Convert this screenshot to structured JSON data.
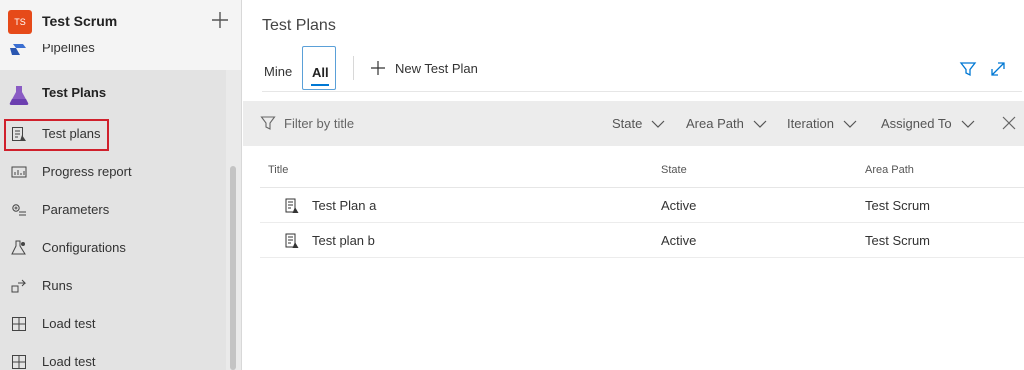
{
  "project": {
    "initials": "TS",
    "name": "Test Scrum",
    "avatar_color": "#e64a19"
  },
  "sidebar": {
    "partial_item": {
      "label": "Pipelines",
      "icon": "pipelines-icon"
    },
    "group": {
      "label": "Test Plans",
      "icon": "test-plans-flask-icon"
    },
    "items": [
      {
        "label": "Test plans",
        "icon": "test-plan-icon",
        "highlighted": true
      },
      {
        "label": "Progress report",
        "icon": "progress-report-icon"
      },
      {
        "label": "Parameters",
        "icon": "parameters-icon"
      },
      {
        "label": "Configurations",
        "icon": "configurations-icon"
      },
      {
        "label": "Runs",
        "icon": "runs-icon"
      },
      {
        "label": "Load test",
        "icon": "load-test-grid-icon"
      },
      {
        "label": "Load test",
        "icon": "load-test-grid-icon"
      }
    ]
  },
  "main": {
    "title": "Test Plans",
    "tabs": [
      {
        "label": "Mine",
        "selected": false
      },
      {
        "label": "All",
        "selected": true
      }
    ],
    "new_button_label": "New Test Plan",
    "filter": {
      "placeholder": "Filter by title",
      "dropdowns": [
        "State",
        "Area Path",
        "Iteration",
        "Assigned To"
      ]
    },
    "table": {
      "columns": [
        "Title",
        "State",
        "Area Path"
      ],
      "rows": [
        {
          "title": "Test Plan a",
          "state": "Active",
          "area_path": "Test Scrum"
        },
        {
          "title": "Test plan b",
          "state": "Active",
          "area_path": "Test Scrum"
        }
      ]
    }
  },
  "colors": {
    "accent": "#0078d4",
    "highlight_border": "#d0202c",
    "sidebar_bg": "#eaeaea",
    "filter_bar_bg": "#ececec"
  }
}
